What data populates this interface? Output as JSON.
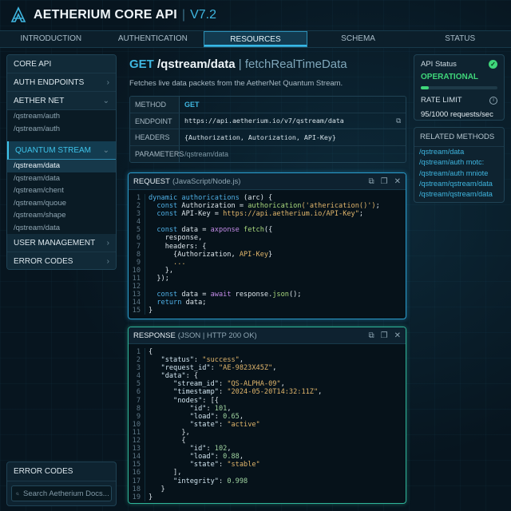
{
  "header": {
    "title": "AETHERIUM CORE API",
    "separator": "|",
    "version": "V7.2",
    "logo_icon": "aetherium-logo-icon"
  },
  "nav": {
    "tabs": [
      {
        "label": "INTRODUCTION"
      },
      {
        "label": "AUTHENTICATION"
      },
      {
        "label": "RESOURCES",
        "active": true
      },
      {
        "label": "SCHEMA"
      },
      {
        "label": "STATUS"
      }
    ]
  },
  "sidebar": {
    "core_api": "CORE API",
    "auth_endpoints": "AUTH ENDPOINTS",
    "aether_net": "AETHER NET",
    "aether_net_items": [
      "/qstream/auth",
      "/qstream/auth"
    ],
    "quantum_stream": "QUANTUM STREAM",
    "quantum_stream_items": [
      "/qstream/data",
      "/qstream/data",
      "/qstream/chent",
      "/qstream/quoue",
      "/qstream/shape",
      "/qstream/data"
    ],
    "user_management": "USER MANAGEMENT",
    "error_codes": "ERROR CODES",
    "chevron_right": "›",
    "chevron_down": "⌄"
  },
  "sidebar_bottom": {
    "title": "ERROR CODES",
    "search_placeholder": "Search Aetherium Docs..."
  },
  "main": {
    "method": "GET",
    "path": "/qstream/data",
    "separator": "|",
    "function": "fetchRealTimeData",
    "description": "Fetches live data packets from the AetherNet Quantum Stream.",
    "table": {
      "method_label": "METHOD",
      "method_value": "GET",
      "endpoint_label": "ENDPOINT",
      "endpoint_value": "https://api.aetherium.io/v7/qstream/data",
      "headers_label": "HEADERS",
      "headers_value": "{Authorization, Autorization, API-Key}",
      "parameters_label": "PARAMETERS",
      "parameters_value": "/qstream/data"
    }
  },
  "request": {
    "title": "REQUEST",
    "subtitle": "(JavaScript/Node.js)",
    "lines": [
      [
        [
          "k",
          "dynamic "
        ],
        [
          "k",
          "authorications "
        ],
        [
          "v",
          "(arc) {"
        ]
      ],
      [
        [
          "k",
          "  const "
        ],
        [
          "v",
          "Authorization = "
        ],
        [
          "f",
          "authorication"
        ],
        [
          "s",
          "('atherication()')"
        ],
        [
          "v",
          ";"
        ]
      ],
      [
        [
          "k",
          "  const "
        ],
        [
          "v",
          "API-Key = "
        ],
        [
          "s",
          "https://api.aetherium.io/API-Key\""
        ],
        [
          "v",
          ";"
        ]
      ],
      [],
      [
        [
          "k",
          "  const "
        ],
        [
          "v",
          "data = "
        ],
        [
          "p",
          "axponse "
        ],
        [
          "f",
          "fetch"
        ],
        [
          "v",
          "({"
        ]
      ],
      [
        [
          "v",
          "    response,"
        ]
      ],
      [
        [
          "v",
          "    headers: {"
        ]
      ],
      [
        [
          "v",
          "      {Authorization, "
        ],
        [
          "s",
          "API-Key"
        ],
        [
          "v",
          "}"
        ]
      ],
      [
        [
          "s",
          "      ..."
        ]
      ],
      [
        [
          "v",
          "    },"
        ]
      ],
      [
        [
          "v",
          "  });"
        ]
      ],
      [],
      [
        [
          "k",
          "  const "
        ],
        [
          "v",
          "data = "
        ],
        [
          "p",
          "await "
        ],
        [
          "v",
          "response."
        ],
        [
          "f",
          "json"
        ],
        [
          "v",
          "();"
        ]
      ],
      [
        [
          "k",
          "  return "
        ],
        [
          "v",
          "data;"
        ]
      ],
      [
        [
          "v",
          "}"
        ]
      ]
    ]
  },
  "response": {
    "title": "RESPONSE",
    "subtitle": "(JSON | HTTP 200 OK)",
    "lines": [
      [
        [
          "v",
          "{"
        ]
      ],
      [
        [
          "key",
          "   \"status\""
        ],
        [
          "v",
          ": "
        ],
        [
          "s",
          "\"success\""
        ],
        [
          "v",
          ","
        ]
      ],
      [
        [
          "key",
          "   \"request_id\""
        ],
        [
          "v",
          ": "
        ],
        [
          "s",
          "\"AE-9823X45Z\""
        ],
        [
          "v",
          ","
        ]
      ],
      [
        [
          "key",
          "   \"data\""
        ],
        [
          "v",
          ": {"
        ]
      ],
      [
        [
          "key",
          "      \"stream_id\""
        ],
        [
          "v",
          ": "
        ],
        [
          "s",
          "\"QS-ALPHA-09\""
        ],
        [
          "v",
          ","
        ]
      ],
      [
        [
          "key",
          "      \"timestamp\""
        ],
        [
          "v",
          ": "
        ],
        [
          "s",
          "\"2024-05-20T14:32:11Z\""
        ],
        [
          "v",
          ","
        ]
      ],
      [
        [
          "key",
          "      \"nodes\""
        ],
        [
          "v",
          ": [{"
        ]
      ],
      [
        [
          "key",
          "          \"id\""
        ],
        [
          "v",
          ": "
        ],
        [
          "num",
          "101"
        ],
        [
          "v",
          ","
        ]
      ],
      [
        [
          "key",
          "          \"load\""
        ],
        [
          "v",
          ": "
        ],
        [
          "num",
          "0.65"
        ],
        [
          "v",
          ","
        ]
      ],
      [
        [
          "key",
          "          \"state\""
        ],
        [
          "v",
          ": "
        ],
        [
          "s",
          "\"active\""
        ]
      ],
      [
        [
          "v",
          "        },"
        ]
      ],
      [
        [
          "v",
          "        {"
        ]
      ],
      [
        [
          "key",
          "          \"id\""
        ],
        [
          "v",
          ": "
        ],
        [
          "num",
          "102"
        ],
        [
          "v",
          ","
        ]
      ],
      [
        [
          "key",
          "          \"load\""
        ],
        [
          "v",
          ": "
        ],
        [
          "num",
          "0.88"
        ],
        [
          "v",
          ","
        ]
      ],
      [
        [
          "key",
          "          \"state\""
        ],
        [
          "v",
          ": "
        ],
        [
          "s",
          "\"stable\""
        ]
      ],
      [
        [
          "v",
          "      ],"
        ]
      ],
      [
        [
          "key",
          "      \"integrity\""
        ],
        [
          "v",
          ": "
        ],
        [
          "num",
          "0.998"
        ]
      ],
      [
        [
          "v",
          "   }"
        ]
      ],
      [
        [
          "v",
          "}"
        ]
      ]
    ]
  },
  "status": {
    "label": "API Status",
    "value": "OPERATIONAL",
    "progress_fraction": 0.1,
    "rate_label": "RATE LIMIT",
    "rate_value": "95/1000 requests/sec",
    "colors": {
      "ok": "#3fd67a"
    }
  },
  "related": {
    "title": "RELATED METHODS",
    "items": [
      "/qstream/data",
      "/qstream/auth motc:",
      "/qstream/auth mniote",
      "/qstream/qstream/data",
      "/qstream/qstream/data"
    ]
  },
  "colors": {
    "accent": "#3fb6e0",
    "request_border": "#2a9ccc",
    "response_border": "#2fb59a"
  }
}
